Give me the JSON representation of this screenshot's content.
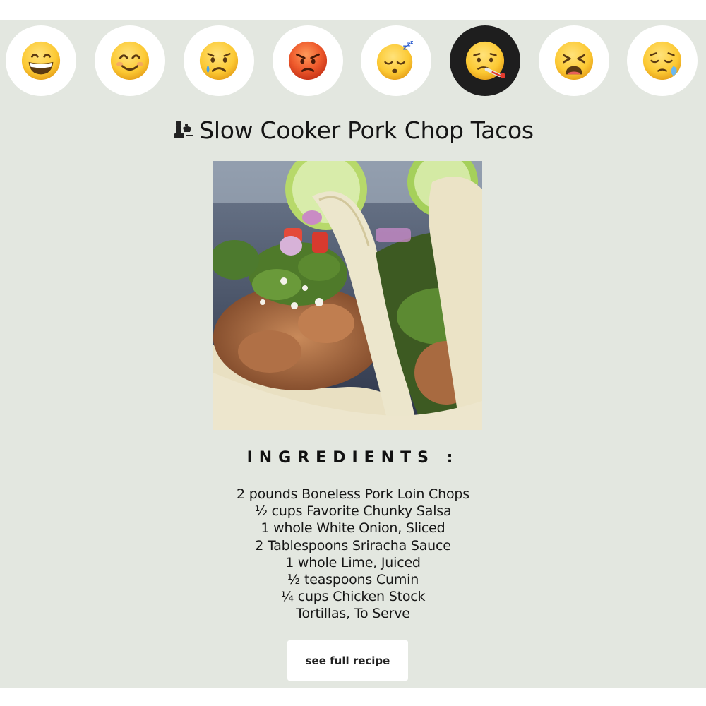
{
  "moods": [
    {
      "name": "grinning-face",
      "active": false
    },
    {
      "name": "smiling-face",
      "active": false
    },
    {
      "name": "crying-face",
      "active": false
    },
    {
      "name": "angry-face",
      "active": false
    },
    {
      "name": "sleeping-face",
      "active": false
    },
    {
      "name": "face-with-thermometer",
      "active": true
    },
    {
      "name": "tired-face",
      "active": false
    },
    {
      "name": "sleepy-face",
      "active": false
    }
  ],
  "recipe": {
    "title_icon": "chef-cooking-icon",
    "title": "Slow Cooker Pork Chop Tacos",
    "photo_subject": "pork chop tacos photo",
    "ingredients_heading": "INGREDIENTS :",
    "ingredients": [
      "2 pounds Boneless Pork Loin Chops",
      "½ cups Favorite Chunky Salsa",
      "1 whole White Onion, Sliced",
      "2 Tablespoons Sriracha Sauce",
      "1 whole Lime, Juiced",
      "½ teaspoons Cumin",
      "¼ cups Chicken Stock",
      "Tortillas, To Serve"
    ],
    "full_recipe_label": "see full recipe"
  },
  "colors": {
    "page_background": "#e3e7e0",
    "active_mood_background": "#1e1e1e",
    "mood_button_background": "#ffffff",
    "emoji_yellow": "#fcc933",
    "emoji_red": "#e8452a"
  }
}
